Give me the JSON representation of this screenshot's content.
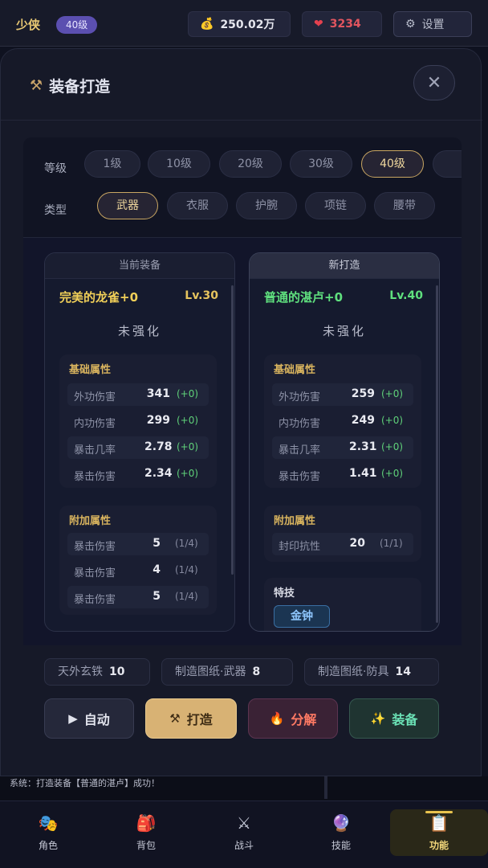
{
  "topbar": {
    "player_name": "少侠",
    "player_level": "40级",
    "gold": "250.02万",
    "hearts": "3234",
    "settings_label": "设置"
  },
  "modal": {
    "title": "装备打造",
    "close_label": "✕"
  },
  "filters": {
    "level_label": "等级",
    "levels": [
      "1级",
      "10级",
      "20级",
      "30级",
      "40级"
    ],
    "selected_level": "40级",
    "type_label": "类型",
    "types": [
      "武器",
      "衣服",
      "护腕",
      "项链",
      "腰带"
    ],
    "selected_type": "武器"
  },
  "current": {
    "header": "当前装备",
    "name": "完美的龙雀+0",
    "level": "Lv.30",
    "enhance": "未强化",
    "base_title": "基础属性",
    "base_stats": [
      {
        "name": "外功伤害",
        "value": "341",
        "delta": "(+0)"
      },
      {
        "name": "内功伤害",
        "value": "299",
        "delta": "(+0)"
      },
      {
        "name": "暴击几率",
        "value": "2.78",
        "delta": "(+0)"
      },
      {
        "name": "暴击伤害",
        "value": "2.34",
        "delta": "(+0)"
      }
    ],
    "extra_title": "附加属性",
    "extra_stats": [
      {
        "name": "暴击伤害",
        "value": "5",
        "frac": "(1/4)"
      },
      {
        "name": "暴击伤害",
        "value": "4",
        "frac": "(1/4)"
      },
      {
        "name": "暴击伤害",
        "value": "5",
        "frac": "(1/4)"
      }
    ]
  },
  "new_item": {
    "header": "新打造",
    "name": "普通的湛卢+0",
    "level": "Lv.40",
    "enhance": "未强化",
    "base_title": "基础属性",
    "base_stats": [
      {
        "name": "外功伤害",
        "value": "259",
        "delta": "(+0)"
      },
      {
        "name": "内功伤害",
        "value": "249",
        "delta": "(+0)"
      },
      {
        "name": "暴击几率",
        "value": "2.31",
        "delta": "(+0)"
      },
      {
        "name": "暴击伤害",
        "value": "1.41",
        "delta": "(+0)"
      }
    ],
    "extra_title": "附加属性",
    "extra_stats": [
      {
        "name": "封印抗性",
        "value": "20",
        "frac": "(1/1)"
      }
    ],
    "skill_title": "特技",
    "skill": "金钟"
  },
  "materials": [
    {
      "name": "天外玄铁",
      "count": "10"
    },
    {
      "name": "制造图纸·武器",
      "count": "8"
    },
    {
      "name": "制造图纸·防具",
      "count": "14"
    }
  ],
  "actions": {
    "auto": "自动",
    "forge": "打造",
    "salvage": "分解",
    "equip": "装备"
  },
  "log": {
    "text": "系统：打造装备【普通的湛卢】成功！"
  },
  "nav": {
    "items": [
      {
        "label": "角色",
        "icon": "character-icon"
      },
      {
        "label": "背包",
        "icon": "backpack-icon"
      },
      {
        "label": "战斗",
        "icon": "swords-icon"
      },
      {
        "label": "技能",
        "icon": "crystal-ball-icon"
      },
      {
        "label": "功能",
        "icon": "clipboard-icon"
      }
    ],
    "active": "功能"
  },
  "colors": {
    "accent_gold": "#e8c34e",
    "rarity_gold": "#f0cf58",
    "rarity_green": "#5fe07e",
    "stat_positive": "#5fd079"
  }
}
